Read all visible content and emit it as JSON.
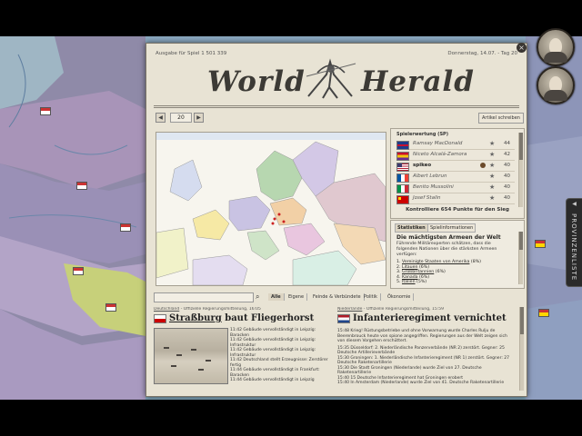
{
  "newspaper": {
    "edition_label": "Ausgabe für Spiel 1 501 339",
    "date_label": "Donnerstag, 14.07. - Tag 20",
    "title_left": "World",
    "title_right": "Herald",
    "page_number": "20",
    "article_button": "Artikel schreiben",
    "close_label": "×"
  },
  "ranking": {
    "title": "Spielerwertung (SP)",
    "rows": [
      {
        "name": "Ramsay MacDonald",
        "points": "44",
        "flag_color": "#c8102e"
      },
      {
        "name": "Niceto Alcalá-Zamora",
        "points": "42",
        "flag_color": "#d4a017"
      },
      {
        "name": "spikeo",
        "points": "40",
        "flag_color": "#b22234"
      },
      {
        "name": "Albert Lebrun",
        "points": "40",
        "flag_color": "#0055a4"
      },
      {
        "name": "Benito Mussolini",
        "points": "40",
        "flag_color": "#009246"
      },
      {
        "name": "Josef Stalin",
        "points": "40",
        "flag_color": "#cc0000"
      }
    ],
    "footer": "Kontrolliere 654 Punkte für den Sieg"
  },
  "stats": {
    "tabs": [
      "Statistiken",
      "Spielinformationen"
    ],
    "heading": "Die mächtigsten Armeen der Welt",
    "intro": "Führende Militärexperten schätzen, dass die folgenden Nationen über die stärksten Armeen verfügen:",
    "list": [
      {
        "rank": "1.",
        "country": "Vereinigte Staaten von Amerika",
        "pct": "(8%)"
      },
      {
        "rank": "2.",
        "country": "Litauen",
        "pct": "(6%)"
      },
      {
        "rank": "3.",
        "country": "Großbritannien",
        "pct": "(6%)"
      },
      {
        "rank": "4.",
        "country": "Kanada",
        "pct": "(6%)"
      },
      {
        "rank": "5.",
        "country": "Italien",
        "pct": "(5%)"
      }
    ]
  },
  "filters": [
    "Alle",
    "Eigene",
    "Feinde & Verbündete",
    "Politik",
    "Ökonomie"
  ],
  "articles": {
    "left": {
      "source": "Deutschland",
      "dateline": "- Offizielle Regierungsmitteilung, 16:05",
      "headline_link": "Straßburg",
      "headline_rest": " baut Fliegerhorst",
      "flag_color": "#cc0000",
      "lines": [
        "11:42 Gebäude vervollständigt in Leipzig: Baracken",
        "11:42 Gebäude vervollständigt in Leipzig: Infrastruktur",
        "11:42 Gebäude vervollständigt in Leipzig: Infrastruktur",
        "11:42 Deutschland stellt Erzeugnisse: Zerstörer fertig",
        "11:44 Gebäude vervollständigt in Frankfurt: Baracken",
        "11:44 Gebäude vervollständigt in Leipzig"
      ]
    },
    "right": {
      "source": "Niederlande",
      "dateline": "- Offizielle Regierungsmitteilung, 15:59",
      "headline": "Infanterieregiment vernichtet",
      "flag_color": "#21468b",
      "lines": [
        "15:48 Krieg! Rüstungsbetriebe und ohne Vorwarnung wurde Charles Rulju de Beerenbrouck heute von spione angegriffen. Regierungen aus der Welt zeigen sich von diesem Vorgehen erschüttert.",
        "15:35 Düsseldorf: 2. Niederländische Panzerverbände (NR 2) zerstört. Gegner: 25 Deutsche Artillerieverbände",
        "15:30 Groningen: 1. Niederländische Infanterieregiment (NR 1) zerstört. Gegner: 27 Deutsche Raketenartillerie",
        "15:30 Die Stadt Groningen (Niederlande) wurde Ziel von 27. Deutsche Raketenartillerie",
        "15:40 15 Deutsche Infanterieregiment hat Groningen erobert",
        "15:40 In Amsterdam (Niederlande) wurde Ziel von 41. Deutsche Raketenartillerie"
      ]
    }
  },
  "side_tab": "PROVINZENLISTE",
  "colors": {
    "paper": "#e8e3d4",
    "map_sea": "#7fa3b8"
  }
}
